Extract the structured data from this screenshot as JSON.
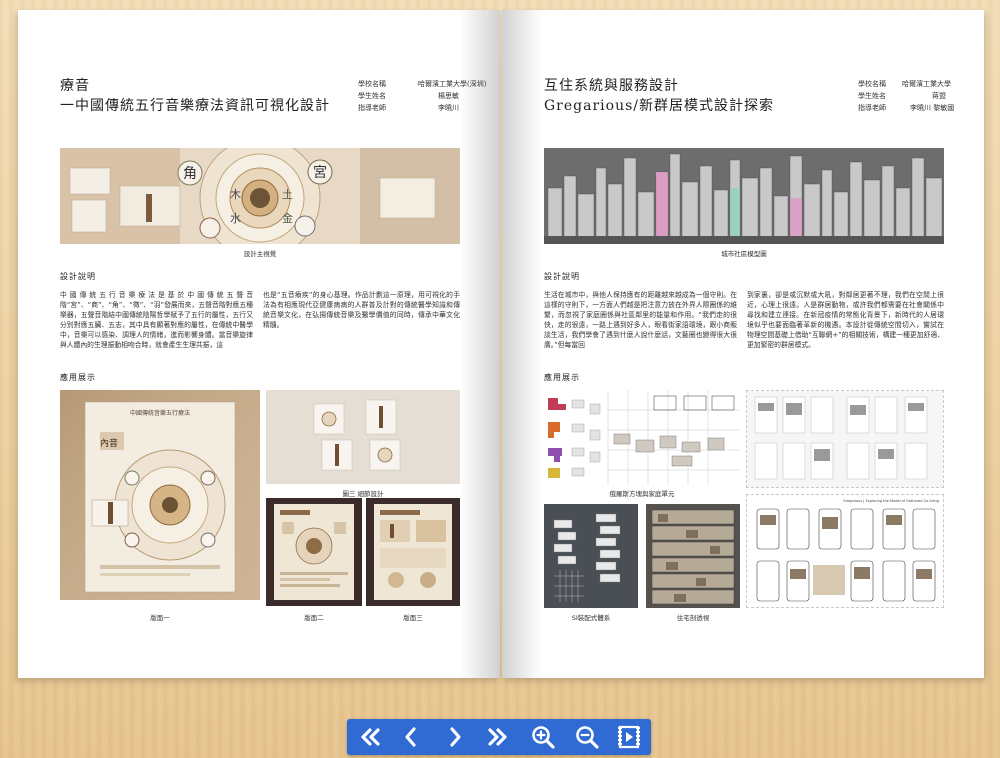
{
  "left_page": {
    "title_line1": "療音",
    "title_line2": "一中國傳統五行音樂療法資訊可視化設計",
    "info": [
      {
        "k": "學校名稱",
        "v": "哈爾濱工業大學(深圳)"
      },
      {
        "k": "學生姓名",
        "v": "楊思敏"
      },
      {
        "k": "指導老師",
        "v": "李曉川"
      }
    ],
    "banner_caption": "設計主視覺",
    "banner_chars": [
      "角",
      "宮",
      "木",
      "土",
      "水",
      "金"
    ],
    "section_desc": "設計說明",
    "desc_col1": "中國傳統五行音樂療法是基於中國傳統五聲音階“宮”、“商”、“角”、“徵”、“羽”發展而來，五聲音階對應五種樂器，五聲音階結中國傳統陰陽哲學賦予了五行的屬性，五行又分別對應五臟、五志，其中具有顯著對應的屬性，在傳統中醫學中，音樂可以感染、調理人的情緒，進而影響身體。當音樂旋律與人體內的生理振動相吻合時，就會產生生理共振，這",
    "desc_col2": "也是“五音療疾”的身心基理。作品計劃這一原理，用可視化的手法為有相應現代亞健康病病的人群普及計對的傳統醫學知識和傳統音樂文化，在弘揚傳統音樂及醫學價值的同時，傳承中華文化精髓。",
    "section_app": "應用展示",
    "captions": [
      "版面一",
      "圖三  細節設計",
      "版面二",
      "版面三"
    ],
    "poster_title": "中國傳統音樂五行療法",
    "poster_mark": "內音"
  },
  "right_page": {
    "title_line1": "互住系統與服務設計",
    "title_line2": "Gregarious/新群居模式設計探索",
    "info": [
      {
        "k": "學校名稱",
        "v": "哈爾濱工業大學"
      },
      {
        "k": "學生姓名",
        "v": "蒋盟"
      },
      {
        "k": "指導老師",
        "v": "李曉川  黎敏國"
      }
    ],
    "banner_caption": "城市社區模型圖",
    "section_desc": "設計說明",
    "desc_col1": "生活在城市中，與他人保持應有的距離越來越成為一個守則。在這樣的守則下，一方面人們越是把注意力放在外界人際圈係的維繫，而忽視了家庭圈係與社區鄰里的能量和作用。“我們走的很快，走的很遠，一路上遇到好多人，眼看街家語環境，跟小商販談生活，我們學會了遇到什麼人說什麼話，文藝圈也變得很大很廣。”但每當回",
    "desc_col2": "到家裏，卻是或沉默或大吼，對鄰居更著不理，我們在空閒上很近，心理上很遠。人是群居動物，或許我們都需要在社會關係中尋找和建立連接。在新冠疫情的常態化背景下，新時代的人居環境似乎也要面臨著革新的機遇。本設計從傳統空間切入，嘗試在物理空間基礎上借助“互聯網+”的相關技術，構建一種更加舒適、更加緊密的群居模式。",
    "section_app": "應用展示",
    "captions": [
      "俄羅斯方塊與家庭單元",
      "SI裝配式體系",
      "住宅剖透視"
    ],
    "screen_header": "Gregarious | Exploring the Model of Gathered Co-living"
  },
  "toolbar": [
    {
      "name": "first-page-icon",
      "label": "first"
    },
    {
      "name": "prev-page-icon",
      "label": "prev"
    },
    {
      "name": "next-page-icon",
      "label": "next"
    },
    {
      "name": "last-page-icon",
      "label": "last"
    },
    {
      "name": "zoom-in-icon",
      "label": "zoom in"
    },
    {
      "name": "zoom-out-icon",
      "label": "zoom out"
    },
    {
      "name": "slideshow-icon",
      "label": "play"
    }
  ],
  "colors": {
    "toolbar": "#2f6bd3",
    "paper": "#ffffff",
    "desk": "#ecd2a4"
  }
}
